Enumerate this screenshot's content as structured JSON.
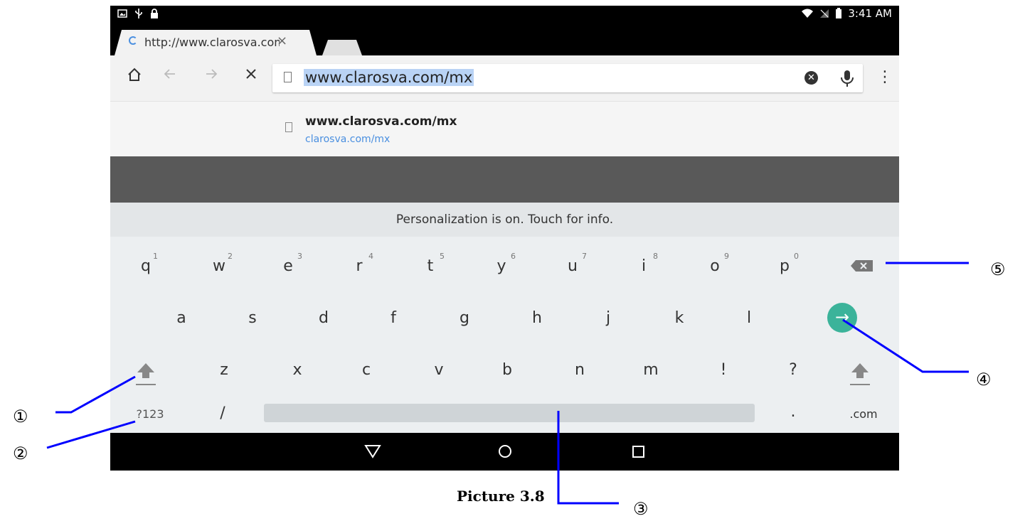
{
  "status_bar": {
    "time": "3:41 AM"
  },
  "browser": {
    "tab_title": "http://www.clarosva.com/mx",
    "tab_close": "×",
    "omnibox_url": "www.clarosva.com/mx",
    "suggestion": {
      "title": "www.clarosva.com/mx",
      "url": "clarosva.com/mx"
    }
  },
  "keyboard": {
    "personalization": "Personalization is on. Touch for info.",
    "row1": [
      "q",
      "w",
      "e",
      "r",
      "t",
      "y",
      "u",
      "i",
      "o",
      "p"
    ],
    "row1_hints": [
      "1",
      "2",
      "3",
      "4",
      "5",
      "6",
      "7",
      "8",
      "9",
      "0"
    ],
    "row2": [
      "a",
      "s",
      "d",
      "f",
      "g",
      "h",
      "j",
      "k",
      "l"
    ],
    "row3": [
      "z",
      "x",
      "c",
      "v",
      "b",
      "n",
      "m",
      "!",
      "?"
    ],
    "symbols_key": "?123",
    "slash_key": "/",
    "period_key": ".",
    "com_key": ".com"
  },
  "annotations": {
    "caption": "Picture 3.8",
    "callouts": [
      "①",
      "②",
      "③",
      "④",
      "⑤"
    ]
  },
  "colors": {
    "go_key": "#3bb39a",
    "annotation_line": "#0000ff",
    "url_highlight": "#b9d3f5"
  }
}
